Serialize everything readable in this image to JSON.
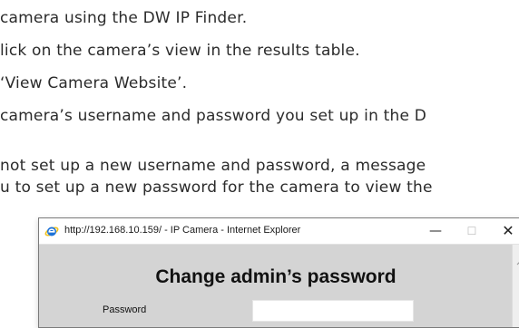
{
  "document": {
    "lines": [
      "camera using the DW IP Finder.",
      "lick on the camera’s view in the results table.",
      "‘View Camera Website’.",
      "camera’s username and password you set up in the D",
      "not set up a new username and password, a message",
      "u to set up a new password for the camera to view the"
    ]
  },
  "window": {
    "title": "http://192.168.10.159/ - IP Camera - Internet Explorer",
    "minimize_glyph": "—",
    "maximize_glyph": "☐",
    "close_glyph": "✕",
    "icon": "internet-explorer-icon"
  },
  "form": {
    "heading": "Change admin’s password",
    "password_label": "Password",
    "password_value": ""
  },
  "colors": {
    "content_bg": "#d4d4d4",
    "ie_blue": "#1e73d8",
    "ie_ring": "#f2c21b"
  }
}
